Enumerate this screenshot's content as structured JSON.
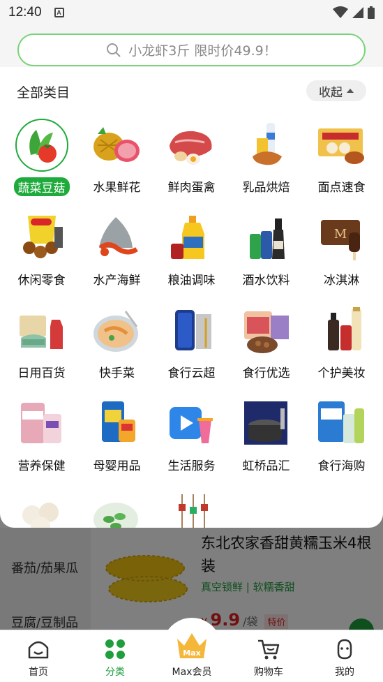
{
  "status_bar": {
    "time": "12:40",
    "a_icon": "A"
  },
  "search": {
    "placeholder": "小龙虾3斤 限时价49.9！"
  },
  "panel": {
    "title": "全部类目",
    "collapse_label": "收起",
    "categories": [
      {
        "label": "蔬菜豆菇",
        "selected": true
      },
      {
        "label": "水果鲜花"
      },
      {
        "label": "鲜肉蛋禽"
      },
      {
        "label": "乳品烘焙"
      },
      {
        "label": "面点速食"
      },
      {
        "label": "休闲零食"
      },
      {
        "label": "水产海鲜"
      },
      {
        "label": "粮油调味"
      },
      {
        "label": "酒水饮料"
      },
      {
        "label": "冰淇淋"
      },
      {
        "label": "日用百货"
      },
      {
        "label": "快手菜"
      },
      {
        "label": "食行云超"
      },
      {
        "label": "食行优选"
      },
      {
        "label": "个护美妆"
      },
      {
        "label": "营养保健"
      },
      {
        "label": "母婴用品"
      },
      {
        "label": "生活服务"
      },
      {
        "label": "虹桥品汇"
      },
      {
        "label": "食行海购"
      }
    ]
  },
  "background": {
    "sidebar": [
      "番茄/茄果瓜",
      "豆腐/豆制品"
    ],
    "product": {
      "title": "东北农家香甜黄糯玉米4根装",
      "subtitle": "真空锁鲜 | 软糯香甜",
      "price_symbol": "¥",
      "price": "9.9",
      "unit": "/袋",
      "tag": "特价"
    }
  },
  "bottom_nav": {
    "items": [
      {
        "label": "首页",
        "icon": "home-icon"
      },
      {
        "label": "分类",
        "icon": "category-icon",
        "active": true
      },
      {
        "label": "Max会员",
        "icon": "max-crown-icon",
        "badge": "Max"
      },
      {
        "label": "购物车",
        "icon": "cart-icon"
      },
      {
        "label": "我的",
        "icon": "profile-icon"
      }
    ]
  },
  "colors": {
    "accent": "#1faa3c",
    "price": "#e02020",
    "search_border": "#7ad37a"
  }
}
